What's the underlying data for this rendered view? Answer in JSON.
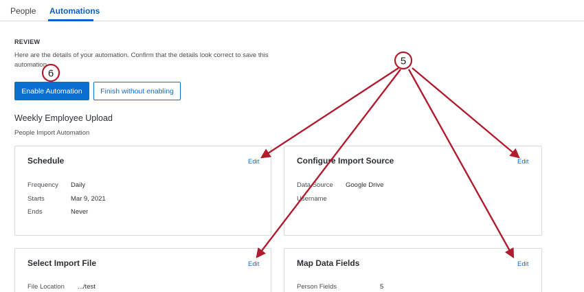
{
  "tabs": [
    {
      "label": "People",
      "active": false
    },
    {
      "label": "Automations",
      "active": true
    }
  ],
  "review": {
    "heading": "REVIEW",
    "description": "Here are the details of your automation. Confirm that the details look correct to save this automation."
  },
  "buttons": {
    "enable": "Enable Automation",
    "finish": "Finish without enabling"
  },
  "automation": {
    "name": "Weekly Employee Upload",
    "type": "People Import Automation"
  },
  "cards": {
    "schedule": {
      "title": "Schedule",
      "edit": "Edit",
      "rows": [
        {
          "label": "Frequency",
          "value": "Daily"
        },
        {
          "label": "Starts",
          "value": "Mar 9, 2021"
        },
        {
          "label": "Ends",
          "value": "Never"
        }
      ]
    },
    "source": {
      "title": "Configure Import Source",
      "edit": "Edit",
      "rows": [
        {
          "label": "Data Source",
          "value": "Google Drive"
        },
        {
          "label": "Username",
          "value": ""
        }
      ]
    },
    "file": {
      "title": "Select Import File",
      "edit": "Edit",
      "rows": [
        {
          "label": "File Location",
          "value": ".../test"
        }
      ]
    },
    "map": {
      "title": "Map Data Fields",
      "edit": "Edit",
      "rows": [
        {
          "label": "Person Fields",
          "value": "5"
        }
      ]
    }
  },
  "callouts": {
    "five": "5",
    "six": "6"
  },
  "colors": {
    "accent": "#0b6fd1",
    "callout": "#b01c2e"
  }
}
